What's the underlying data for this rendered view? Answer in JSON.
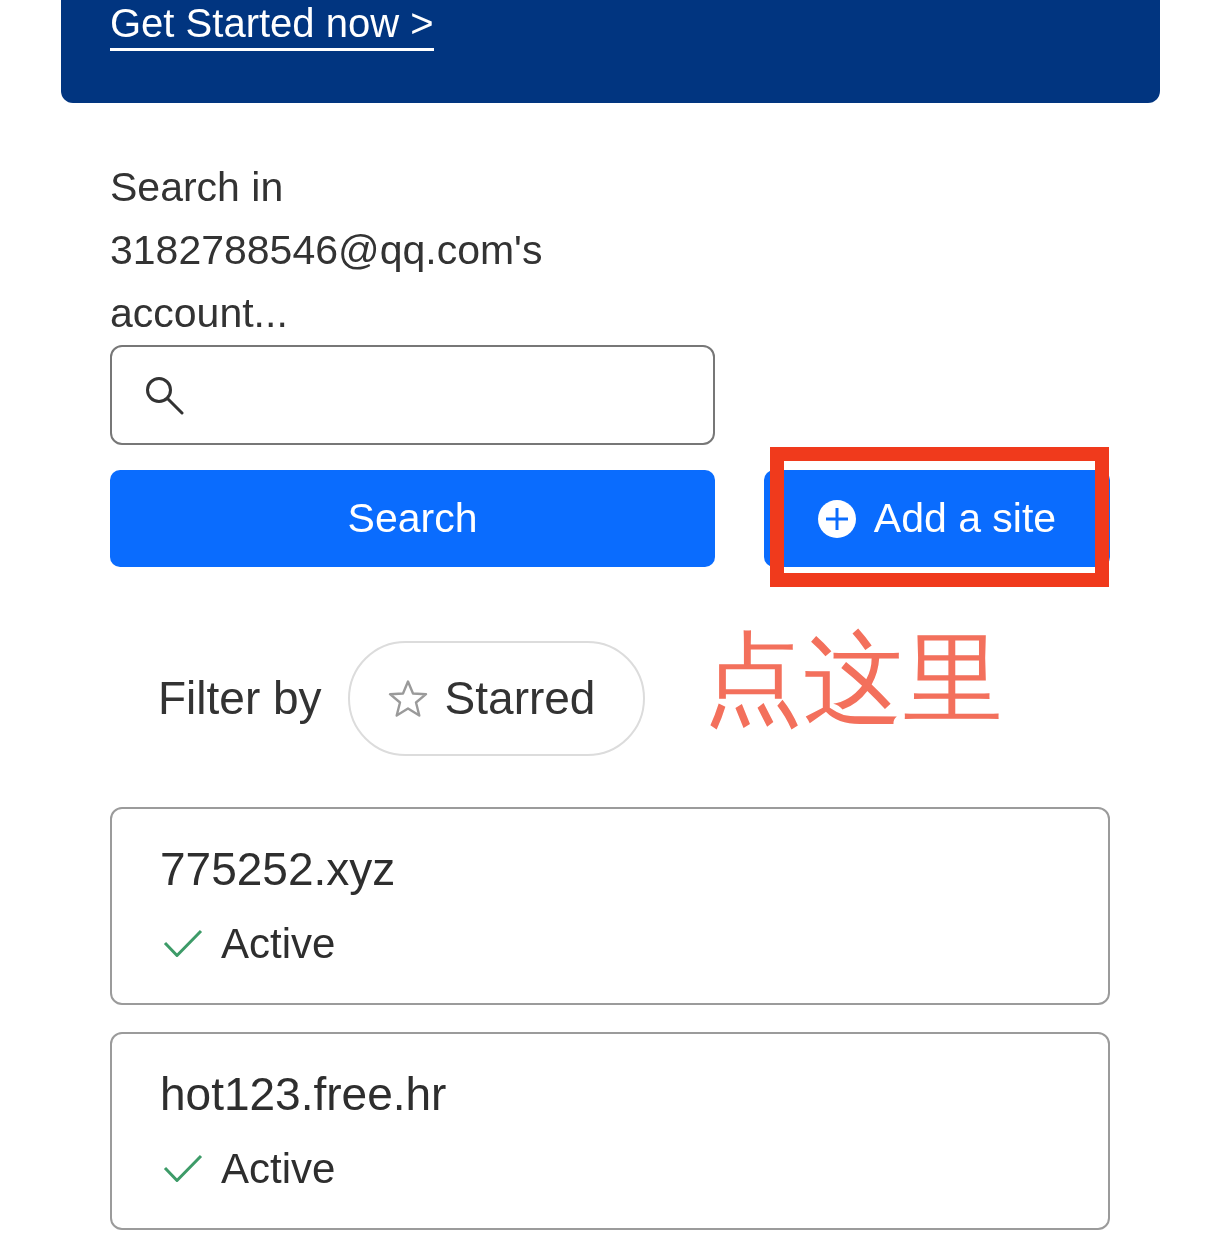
{
  "banner": {
    "link": "Get Started now >"
  },
  "search": {
    "label": "Search in 3182788546@qq.com's account...",
    "button": "Search"
  },
  "add_site_button": {
    "label": "Add a site",
    "highlighted": true
  },
  "annotation": {
    "text": "点这里"
  },
  "filter": {
    "label": "Filter by",
    "chips": [
      {
        "label": "Starred",
        "selected": false
      }
    ]
  },
  "sites": [
    {
      "domain": "775252.xyz",
      "status": "Active"
    },
    {
      "domain": "hot123.free.hr",
      "status": "Active"
    }
  ]
}
